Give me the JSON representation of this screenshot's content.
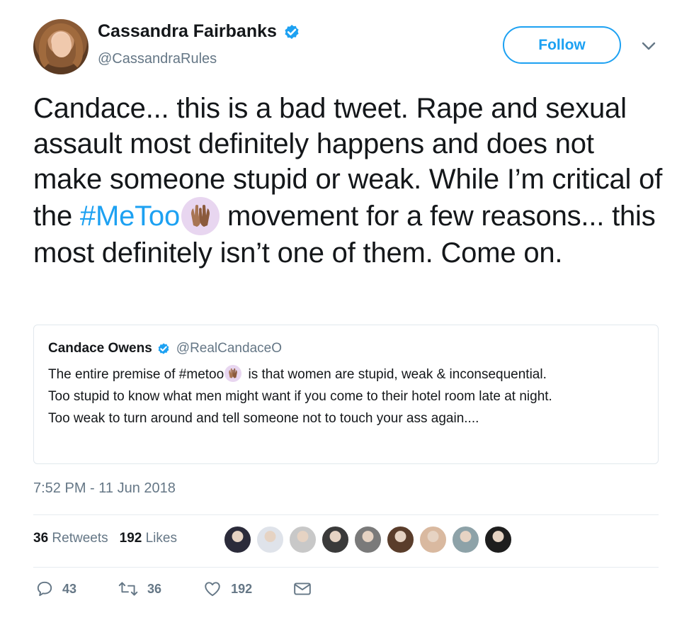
{
  "author": {
    "display_name": "Cassandra Fairbanks",
    "handle": "@CassandraRules",
    "verified": true
  },
  "follow_button": {
    "label": "Follow"
  },
  "tweet": {
    "text_before_hashtag": "Candace... this is a bad tweet. Rape and sexual assault most definitely happens and does not make someone stupid or weak. While I’m critical of the ",
    "hashtag": "#MeToo",
    "text_after_hashtag": " movement for a few reasons... this most definitely isn’t one of them. Come on."
  },
  "quoted_tweet": {
    "display_name": "Candace Owens",
    "handle": "@RealCandaceO",
    "verified": true,
    "line1_before": "The entire premise of #metoo",
    "line1_after": " is that women are stupid, weak & inconsequential.",
    "line2": "Too stupid to know what men might want if you come to their hotel room late at night.",
    "line3": "Too weak to turn around and tell someone not to touch your ass again...."
  },
  "timestamp": "7:52 PM - 11 Jun 2018",
  "stats": {
    "retweets_count": "36",
    "retweets_label": "Retweets",
    "likes_count": "192",
    "likes_label": "Likes"
  },
  "likers": [
    {
      "color": "#2b2b3a"
    },
    {
      "color": "#dfe3ea"
    },
    {
      "color": "#c8c8c8"
    },
    {
      "color": "#3a3a3a"
    },
    {
      "color": "#7a7a7a"
    },
    {
      "color": "#5a3d2b"
    },
    {
      "color": "#d9b9a0"
    },
    {
      "color": "#8da2a8"
    },
    {
      "color": "#1e1e1e"
    }
  ],
  "actions": {
    "reply_count": "43",
    "retweet_count": "36",
    "like_count": "192"
  },
  "colors": {
    "accent": "#1da1f2",
    "secondary_text": "#657786",
    "emoji_bg": "#e8d6f0"
  },
  "icons": [
    "verified-badge-icon",
    "chevron-down-icon",
    "raised-hands-emoji",
    "reply-icon",
    "retweet-icon",
    "like-icon",
    "direct-message-icon"
  ]
}
